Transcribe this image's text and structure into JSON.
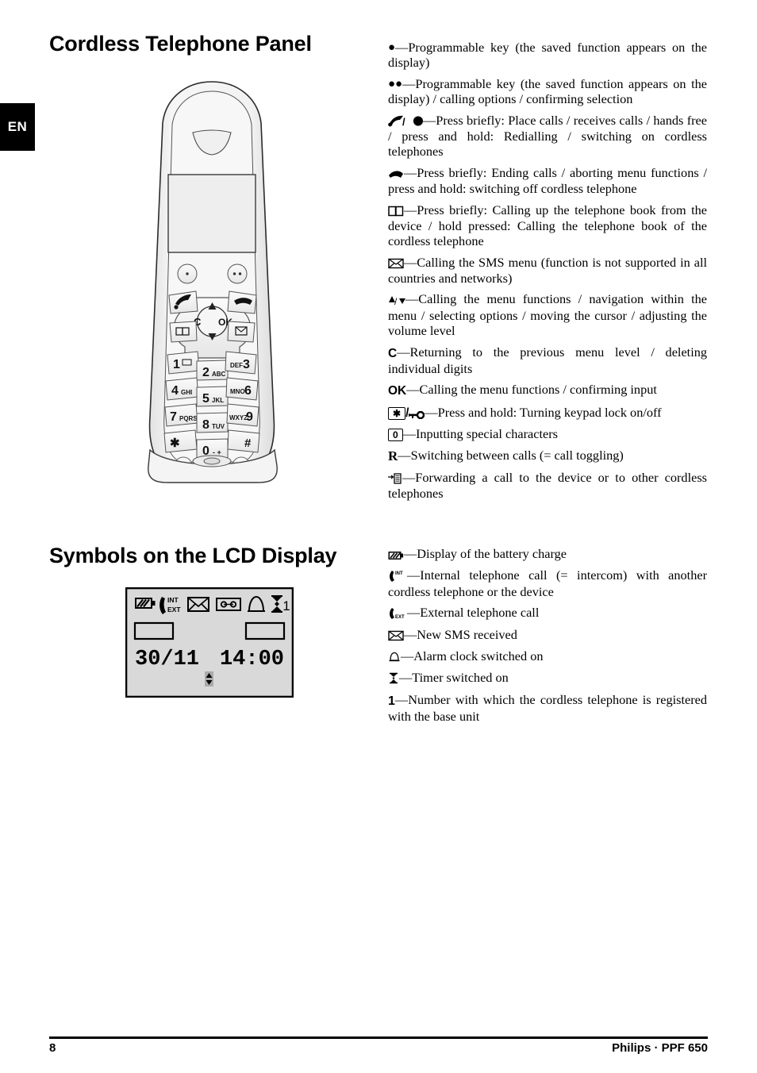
{
  "language_tab": "EN",
  "headings": {
    "panel": "Cordless Telephone Panel",
    "lcd": "Symbols on the LCD Display"
  },
  "panel_keys": [
    {
      "icon": "single-dot-soft-key-icon",
      "text": "—Programmable key (the saved function appears on the display)"
    },
    {
      "icon": "double-dot-soft-key-icon",
      "text": "—Programmable key (the saved function appears on the display) / calling options / confirming selection"
    },
    {
      "icon": "offhook-handset-slash-handsfree-icon",
      "text": "—Press briefly: Place calls / receives calls / hands free / press and hold: Redialling / switching on cordless telephones"
    },
    {
      "icon": "onhook-handset-icon",
      "text": "—Press briefly: Ending calls / aborting menu functions / press and hold: switching off cordless telephone"
    },
    {
      "icon": "open-book-phonebook-icon",
      "text": "—Press briefly: Calling up the telephone book from the device / hold pressed: Calling the telephone book of the cordless telephone"
    },
    {
      "icon": "envelope-sms-icon",
      "text": "—Calling the SMS menu (function is not supported in all countries and networks)"
    },
    {
      "icon": "up-down-arrows-icon",
      "text": "—Calling the menu functions / navigation within the menu / selecting options / moving the cursor / adjusting the volume level"
    },
    {
      "icon": "c-key-icon",
      "label": "C",
      "text": "—Returning to the previous menu level / deleting individual digits"
    },
    {
      "icon": "ok-key-icon",
      "label": "OK",
      "text": "—Calling the menu functions / confirming input"
    },
    {
      "icon": "star-key-slash-keylock-icon",
      "label": "✱",
      "text": "—Press and hold: Turning keypad lock on/off"
    },
    {
      "icon": "zero-key-icon",
      "label": "0",
      "text": "—Inputting special characters"
    },
    {
      "icon": "r-key-icon",
      "label": "R",
      "text": "—Switching between calls (= call toggling)"
    },
    {
      "icon": "call-forward-to-device-icon",
      "text": "—Forwarding a call to the device or to other cordless telephones"
    }
  ],
  "lcd_symbols": [
    {
      "icon": "battery-icon",
      "text": "—Display of the battery charge"
    },
    {
      "icon": "handset-int-icon",
      "text": "—Internal telephone call (= intercom) with another cordless telephone or the device"
    },
    {
      "icon": "handset-ext-icon",
      "text": "—External telephone call"
    },
    {
      "icon": "envelope-sms-icon",
      "text": "—New SMS received"
    },
    {
      "icon": "alarm-bell-icon",
      "text": "—Alarm clock switched on"
    },
    {
      "icon": "hourglass-timer-icon",
      "text": "—Timer switched on"
    },
    {
      "icon": "handset-number-icon",
      "label": "1",
      "text": "—Number with which the cordless telephone is registered with the base unit"
    }
  ],
  "lcd_screen": {
    "status_icons": [
      "battery-icon",
      "handset-int-ext-icon",
      "envelope-sms-icon",
      "answering-machine-icon",
      "alarm-bell-icon",
      "hourglass-timer-icon"
    ],
    "handset_number": "1",
    "date": "30/11",
    "time": "14:00",
    "scroll_indicator": "up-down-arrows-icon"
  },
  "keypad": {
    "keys": [
      {
        "main": "1",
        "sub": "✉"
      },
      {
        "main": "2",
        "sub": "ABC"
      },
      {
        "main": "3",
        "sub": "DEF"
      },
      {
        "main": "4",
        "sub": "GHI"
      },
      {
        "main": "5",
        "sub": "JKL"
      },
      {
        "main": "6",
        "sub": "MNO"
      },
      {
        "main": "7",
        "sub": "PQRS"
      },
      {
        "main": "8",
        "sub": "TUV"
      },
      {
        "main": "9",
        "sub": "WXYZ"
      },
      {
        "main": "✱",
        "sub": ""
      },
      {
        "main": "0",
        "sub": "- +"
      },
      {
        "main": "#",
        "sub": ""
      }
    ],
    "nav_left": "C",
    "nav_right": "OK",
    "r_key": "R"
  },
  "footer": {
    "page_number": "8",
    "brand": "Philips · PPF 650"
  },
  "colors": {
    "text": "#000000",
    "background": "#ffffff",
    "tab_background": "#000000",
    "lcd_background": "#d9d9d9",
    "phone_body": "#f2f2f2"
  }
}
